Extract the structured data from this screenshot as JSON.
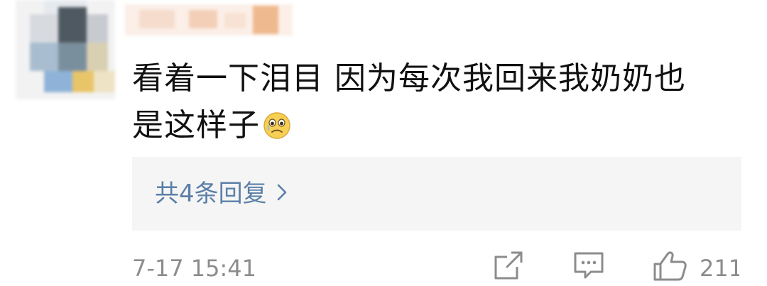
{
  "comment": {
    "text_line1": "看着一下泪目 因为每次我回来我奶奶也",
    "text_line2": "是这样子",
    "emoji_icon": "tearful-face-emoji"
  },
  "replies": {
    "label": "共4条回复",
    "chevron_icon": "chevron-right-icon",
    "link_color": "#5b7fa8"
  },
  "meta": {
    "timestamp": "7-17 15:41",
    "like_count": "211"
  },
  "actions": {
    "share_icon": "share-icon",
    "comment_icon": "comment-icon",
    "like_icon": "thumbs-up-icon"
  },
  "colors": {
    "text": "#111111",
    "muted": "#8c8c8c",
    "reply_box_bg": "#f5f5f5"
  }
}
